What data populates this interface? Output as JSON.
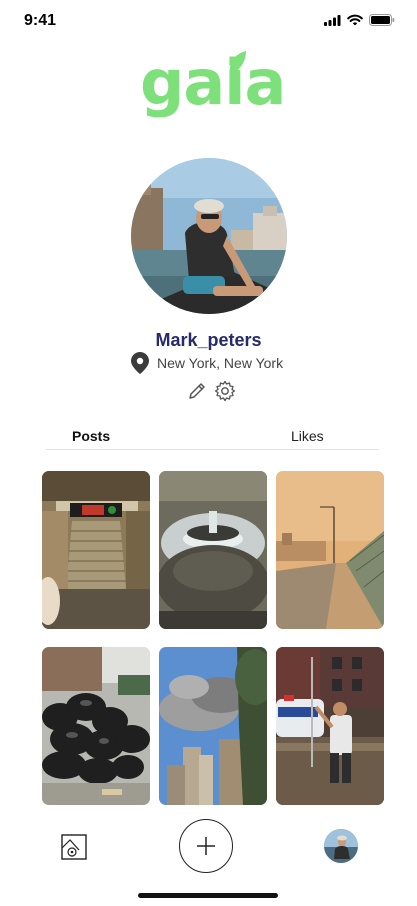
{
  "status_bar": {
    "time": "9:41"
  },
  "app": {
    "logo_text": "gaia",
    "logo_color": "#7ee07a"
  },
  "profile": {
    "username": "Mark_peters",
    "location": "New York, New York"
  },
  "tabs": [
    {
      "label": "Posts",
      "active": true
    },
    {
      "label": "Likes",
      "active": false
    }
  ],
  "posts": [
    {
      "id": "flooded-subway-stairs"
    },
    {
      "id": "water-geyser-street"
    },
    {
      "id": "smoky-orange-sky-highway"
    },
    {
      "id": "trash-bags-pile"
    },
    {
      "id": "smoke-over-buildings"
    },
    {
      "id": "flooded-street-police"
    }
  ],
  "bottom_nav": {
    "gallery_icon": "gallery-icon",
    "add_icon": "plus-icon",
    "profile_icon": "avatar"
  },
  "colors": {
    "accent": "#7ee07a",
    "username": "#272a6b"
  }
}
